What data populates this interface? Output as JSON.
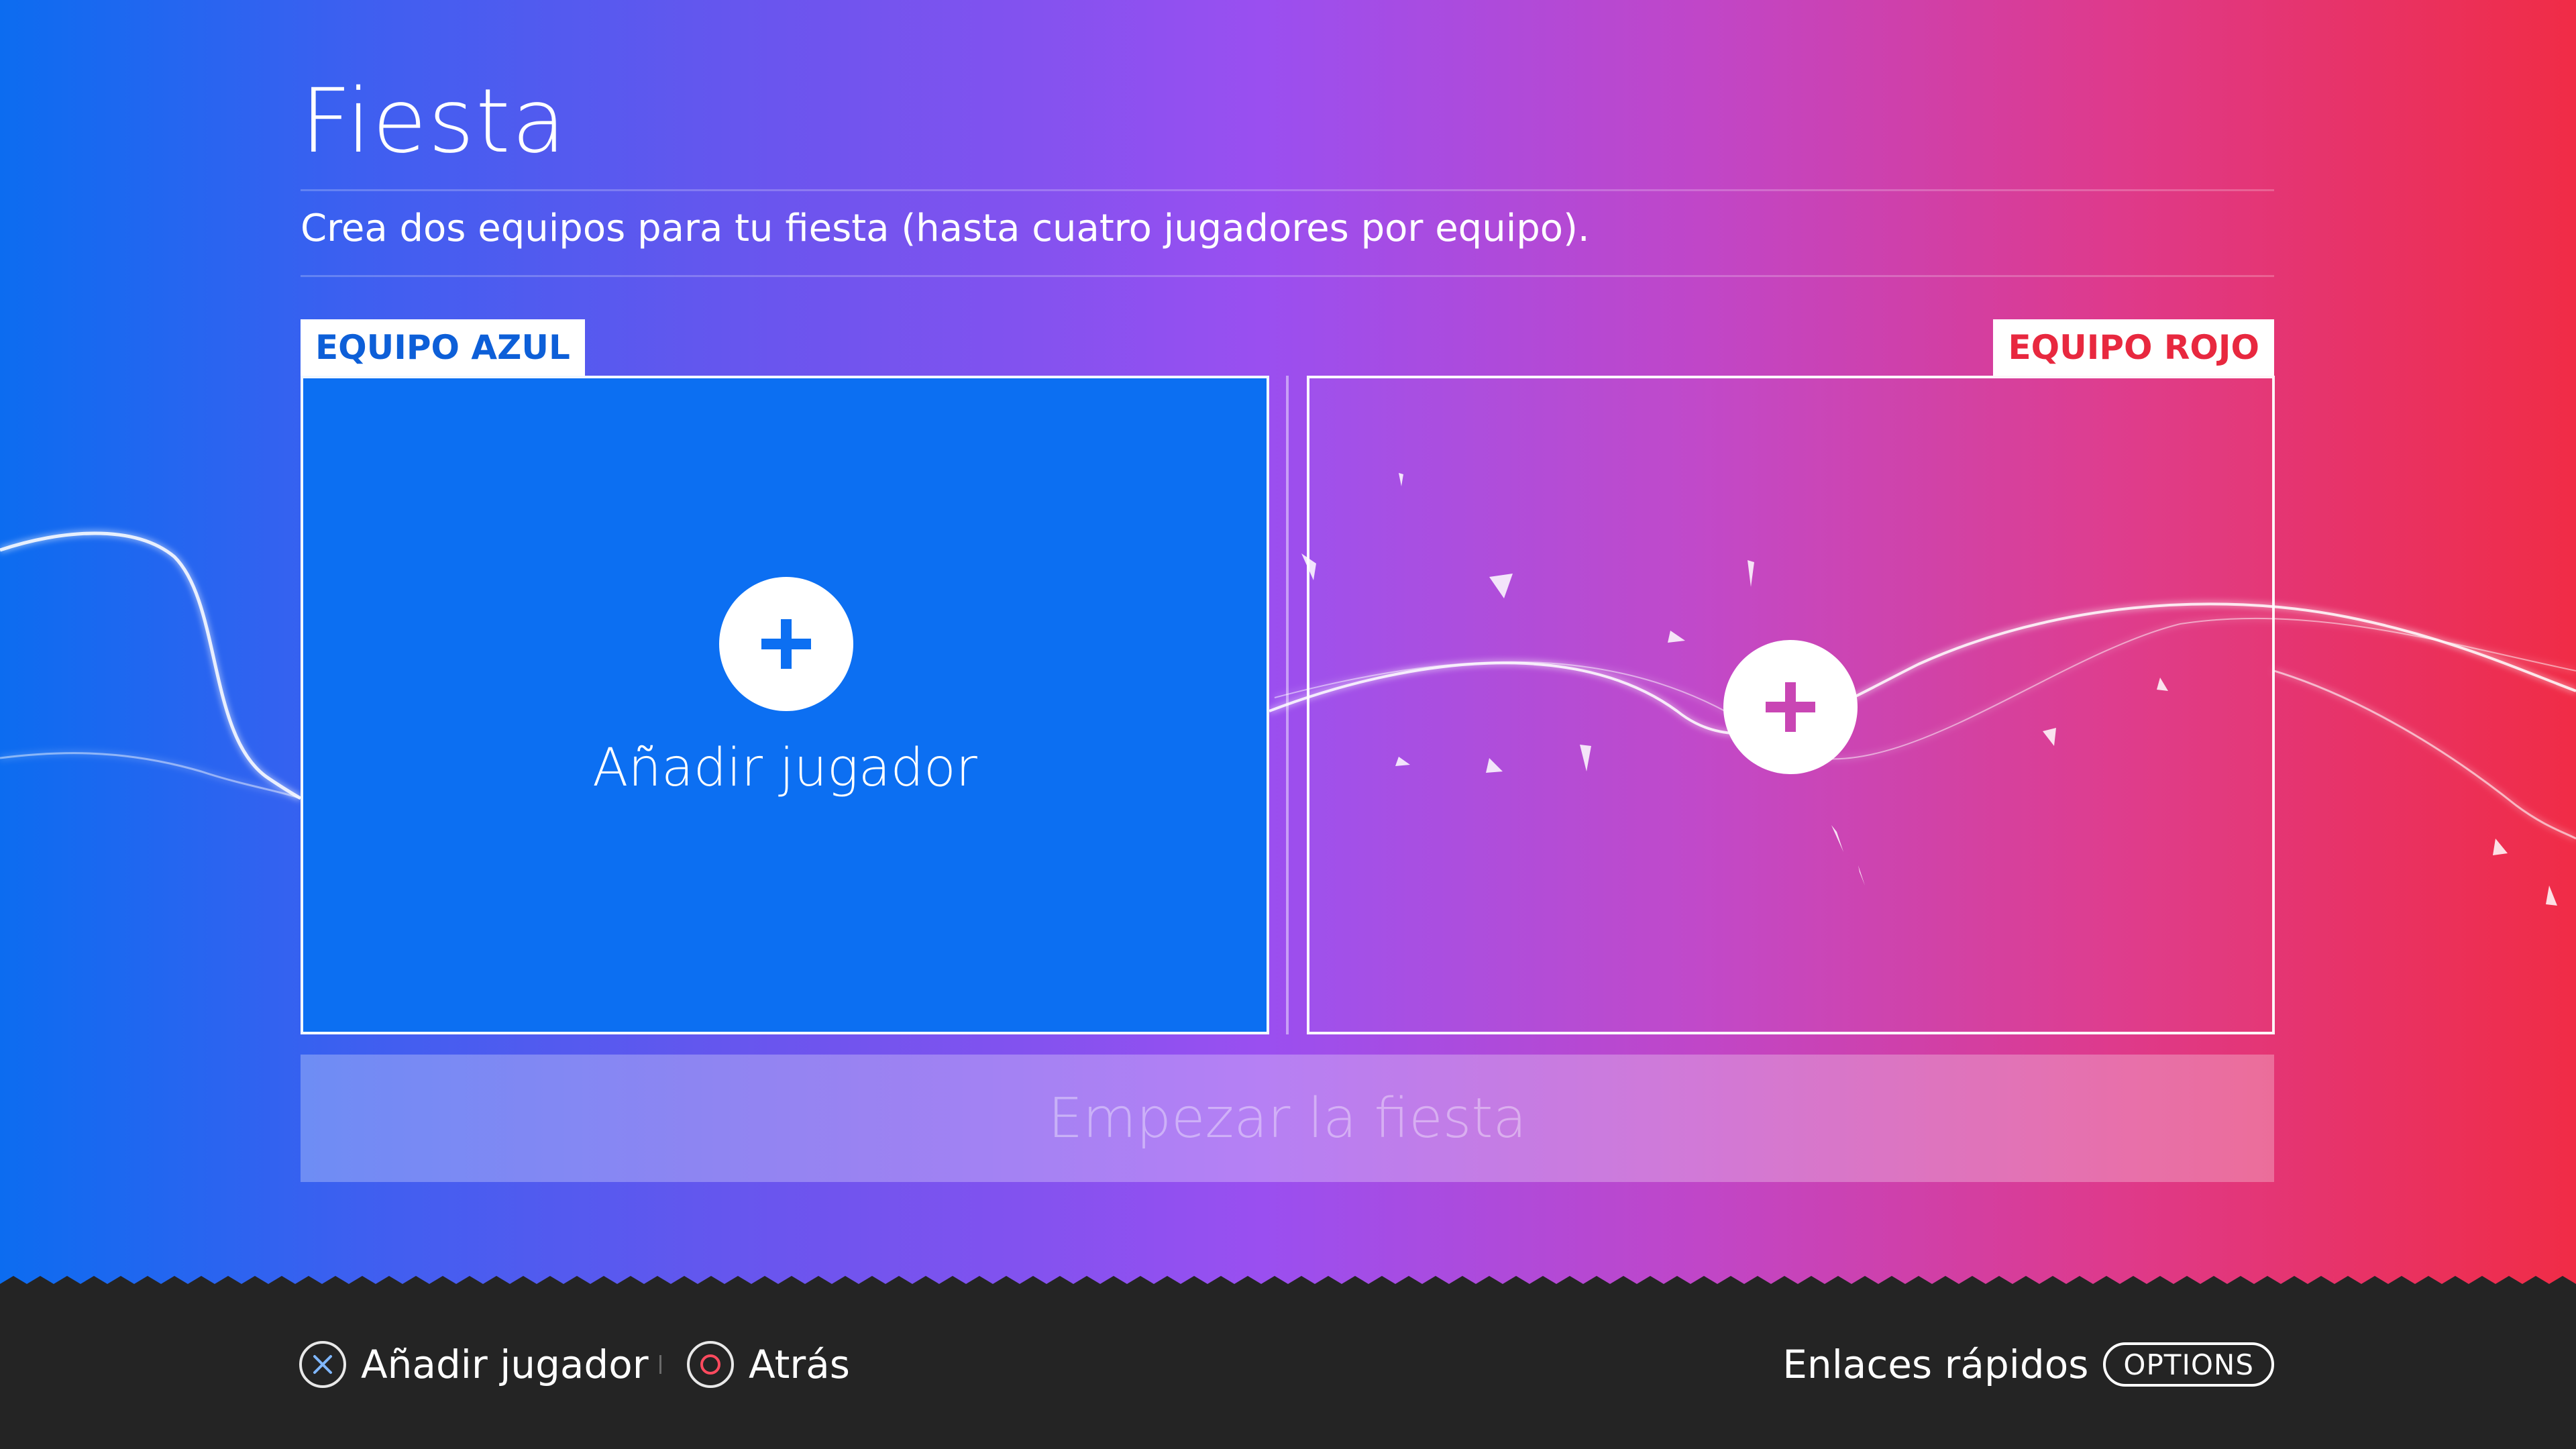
{
  "page": {
    "title": "Fiesta",
    "subtitle": "Crea dos equipos para tu fiesta (hasta cuatro jugadores por equipo)."
  },
  "teams": {
    "blue": {
      "label": "EQUIPO AZUL",
      "add_label": "Añadir jugador",
      "icon": "plus-icon"
    },
    "red": {
      "label": "EQUIPO ROJO",
      "icon": "plus-icon"
    }
  },
  "start_button": {
    "label": "Empezar la fiesta",
    "enabled": false
  },
  "footer": {
    "hints": [
      {
        "icon": "cross-button-icon",
        "label": "Añadir jugador"
      },
      {
        "icon": "circle-button-icon",
        "label": "Atrás"
      }
    ],
    "quick_links": {
      "label": "Enlaces rápidos",
      "button": "OPTIONS"
    }
  },
  "colors": {
    "blue_team": "#0c6ff2",
    "red_team": "#e8283f",
    "footer_bg": "#242424"
  }
}
